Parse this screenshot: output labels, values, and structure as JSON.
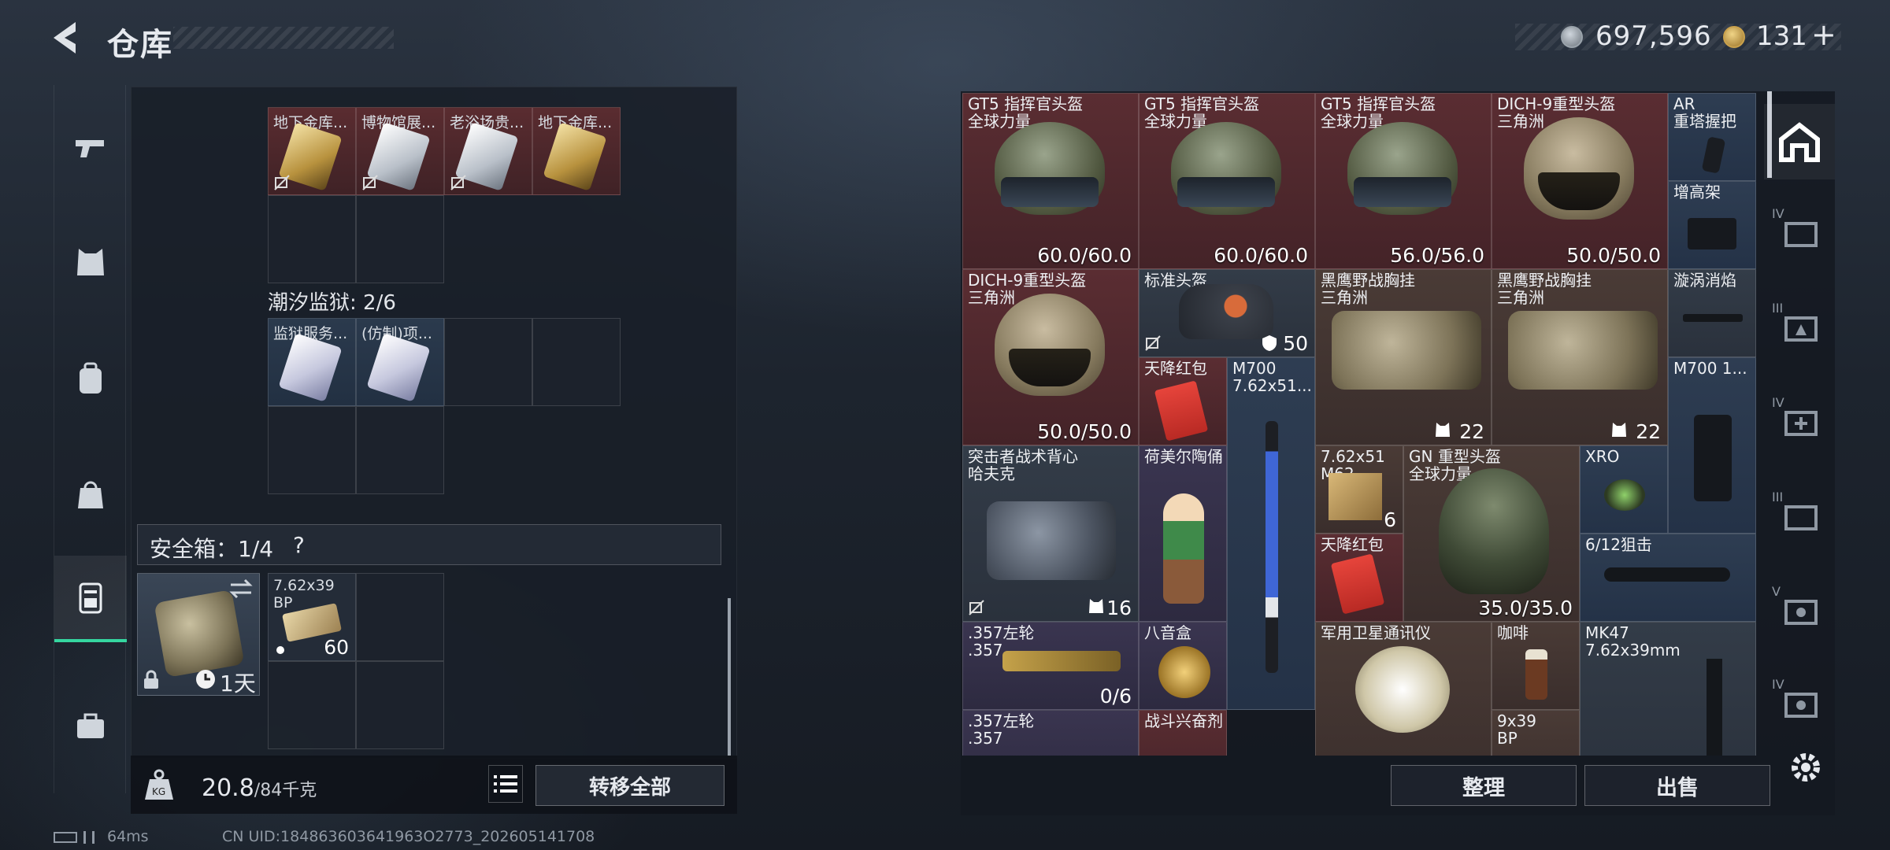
{
  "header": {
    "title": "仓库"
  },
  "currency": {
    "coins": "697,596",
    "premium": "131",
    "plus": "+"
  },
  "left": {
    "top_cells": [
      {
        "label": "地下金库...",
        "card": "gold"
      },
      {
        "label": "博物馆展...",
        "card": "silver"
      },
      {
        "label": "老浴场贵...",
        "card": "silver"
      },
      {
        "label": "地下金库...",
        "card": "gold"
      }
    ],
    "section_title": "潮汐监狱: 2/6",
    "prison_cells": [
      {
        "label": "监狱服务..."
      },
      {
        "label": "(仿制)项..."
      }
    ],
    "safe_title": "安全箱：1/4",
    "safe_help": "?",
    "safe_timer": "1天",
    "safe_ammo": {
      "name": "7.62x39",
      "sub": "BP",
      "count": "60"
    },
    "weight": "20.8",
    "weight_max": "/84千克",
    "transfer_label": "转移全部",
    "status_ping": "64ms",
    "uid": "CN UID:184863603641963O2773_202605141708"
  },
  "right": {
    "items": [
      {
        "name": "GT5 指挥官头盔",
        "sub": "全球力量",
        "dur": "60.0/60.0"
      },
      {
        "name": "GT5 指挥官头盔",
        "sub": "全球力量",
        "dur": "60.0/60.0"
      },
      {
        "name": "GT5 指挥官头盔",
        "sub": "全球力量",
        "dur": "56.0/56.0"
      },
      {
        "name": "DICH-9重型头盔",
        "sub": "三角洲",
        "dur": "50.0/50.0"
      },
      {
        "name": "AR",
        "sub": "重塔握把"
      },
      {
        "name": "增高架"
      },
      {
        "name": "DICH-9重型头盔",
        "sub": "三角洲",
        "dur": "50.0/50.0"
      },
      {
        "name": "标准头盔",
        "dur": "50"
      },
      {
        "name": "黑鹰野战胸挂",
        "sub": "三角洲",
        "dur": "22"
      },
      {
        "name": "黑鹰野战胸挂",
        "sub": "三角洲",
        "dur": "22"
      },
      {
        "name": "漩涡消焰"
      },
      {
        "name": "天降红包"
      },
      {
        "name": "M700",
        "sub": "7.62x51..."
      },
      {
        "name": "M700 1..."
      },
      {
        "name": "突击者战术背心",
        "sub": "哈夫克",
        "dur": "16"
      },
      {
        "name": "荷美尔陶俑"
      },
      {
        "name": "7.62x51",
        "sub": "M62",
        "dur": "6"
      },
      {
        "name": "GN 重型头盔",
        "sub": "全球力量",
        "dur": "35.0/35.0"
      },
      {
        "name": "XRO"
      },
      {
        "name": "天降红包"
      },
      {
        "name": "6/12狙击"
      },
      {
        "name": ".357左轮",
        "sub": ".357",
        "dur": "0/6"
      },
      {
        "name": "八音盒"
      },
      {
        "name": "军用卫星通讯仪"
      },
      {
        "name": "咖啡"
      },
      {
        "name": "MK47",
        "sub": "7.62x39mm"
      },
      {
        "name": ".357左轮",
        "sub": ".357"
      },
      {
        "name": "战斗兴奋剂"
      },
      {
        "name": "9x39",
        "sub": "BP"
      }
    ],
    "sort_label": "整理",
    "sell_label": "出售",
    "side_tabs": [
      "",
      "IV",
      "III",
      "IV",
      "III",
      "V",
      "IV"
    ]
  },
  "colors": {
    "accent": "#35d6a0",
    "red_slot": "#5a2d32",
    "blue_slot": "#2e3d52"
  }
}
